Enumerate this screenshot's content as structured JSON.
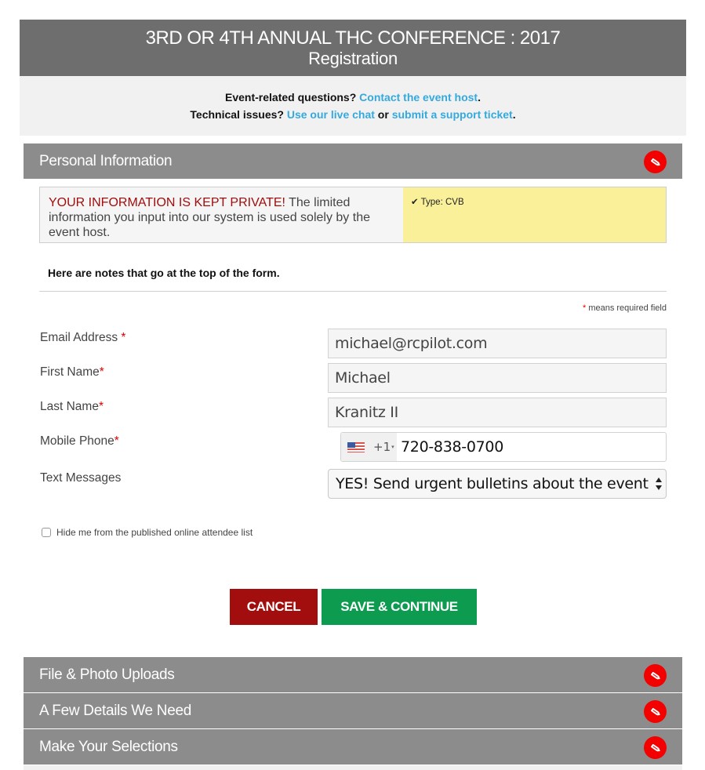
{
  "header": {
    "title": "3RD OR 4TH ANNUAL THC CONFERENCE : 2017",
    "subtitle": "Registration"
  },
  "help": {
    "event_prefix": "Event-related questions? ",
    "event_link": "Contact the event host",
    "event_suffix": ".",
    "tech_prefix": "Technical issues? ",
    "tech_link_chat": "Use our live chat",
    "tech_or": " or ",
    "tech_link_ticket": "submit a support ticket",
    "tech_suffix": "."
  },
  "sections": {
    "personal": {
      "title": "Personal Information",
      "icon": "pencil-icon"
    },
    "uploads": {
      "title": "File & Photo Uploads",
      "icon": "pencil-icon"
    },
    "details": {
      "title": "A Few Details We Need",
      "icon": "pencil-icon"
    },
    "selections": {
      "title": "Make Your Selections",
      "icon": "pencil-icon"
    }
  },
  "privacy": {
    "headline": "YOUR INFORMATION IS KEPT PRIVATE!",
    "body": " The limited information you input into our system is used solely by the event host.",
    "type_check": "✔",
    "type_label": "Type: CVB"
  },
  "form": {
    "notes": "Here are notes that go at the top of the form.",
    "required_star": "*",
    "required_note": " means required field",
    "fields": {
      "email": {
        "label": "Email Address ",
        "required": "*",
        "value": "michael@rcpilot.com"
      },
      "first_name": {
        "label": "First Name",
        "required": "*",
        "value": "Michael"
      },
      "last_name": {
        "label": "Last Name",
        "required": "*",
        "value": "Kranitz II"
      },
      "mobile": {
        "label": "Mobile Phone",
        "required": "*",
        "country": "US",
        "dial_code": "+1",
        "caret": "▾",
        "value": "720-838-0700"
      },
      "text_messages": {
        "label": "Text Messages",
        "selected": "YES! Send urgent bulletins about the event"
      }
    },
    "hide_checkbox": {
      "label": "Hide me from the published online attendee list",
      "checked": false
    }
  },
  "buttons": {
    "cancel": "CANCEL",
    "save": "SAVE & CONTINUE"
  },
  "colors": {
    "header_bg": "#6e6e6e",
    "section_bg": "#8c8c8c",
    "link": "#35a9dd",
    "edit_icon_bg": "#f30000",
    "cancel_bg": "#a20e0e",
    "save_bg": "#0c9b4f",
    "privacy_red": "#a10d0d",
    "type_panel_bg": "#faf09a"
  }
}
